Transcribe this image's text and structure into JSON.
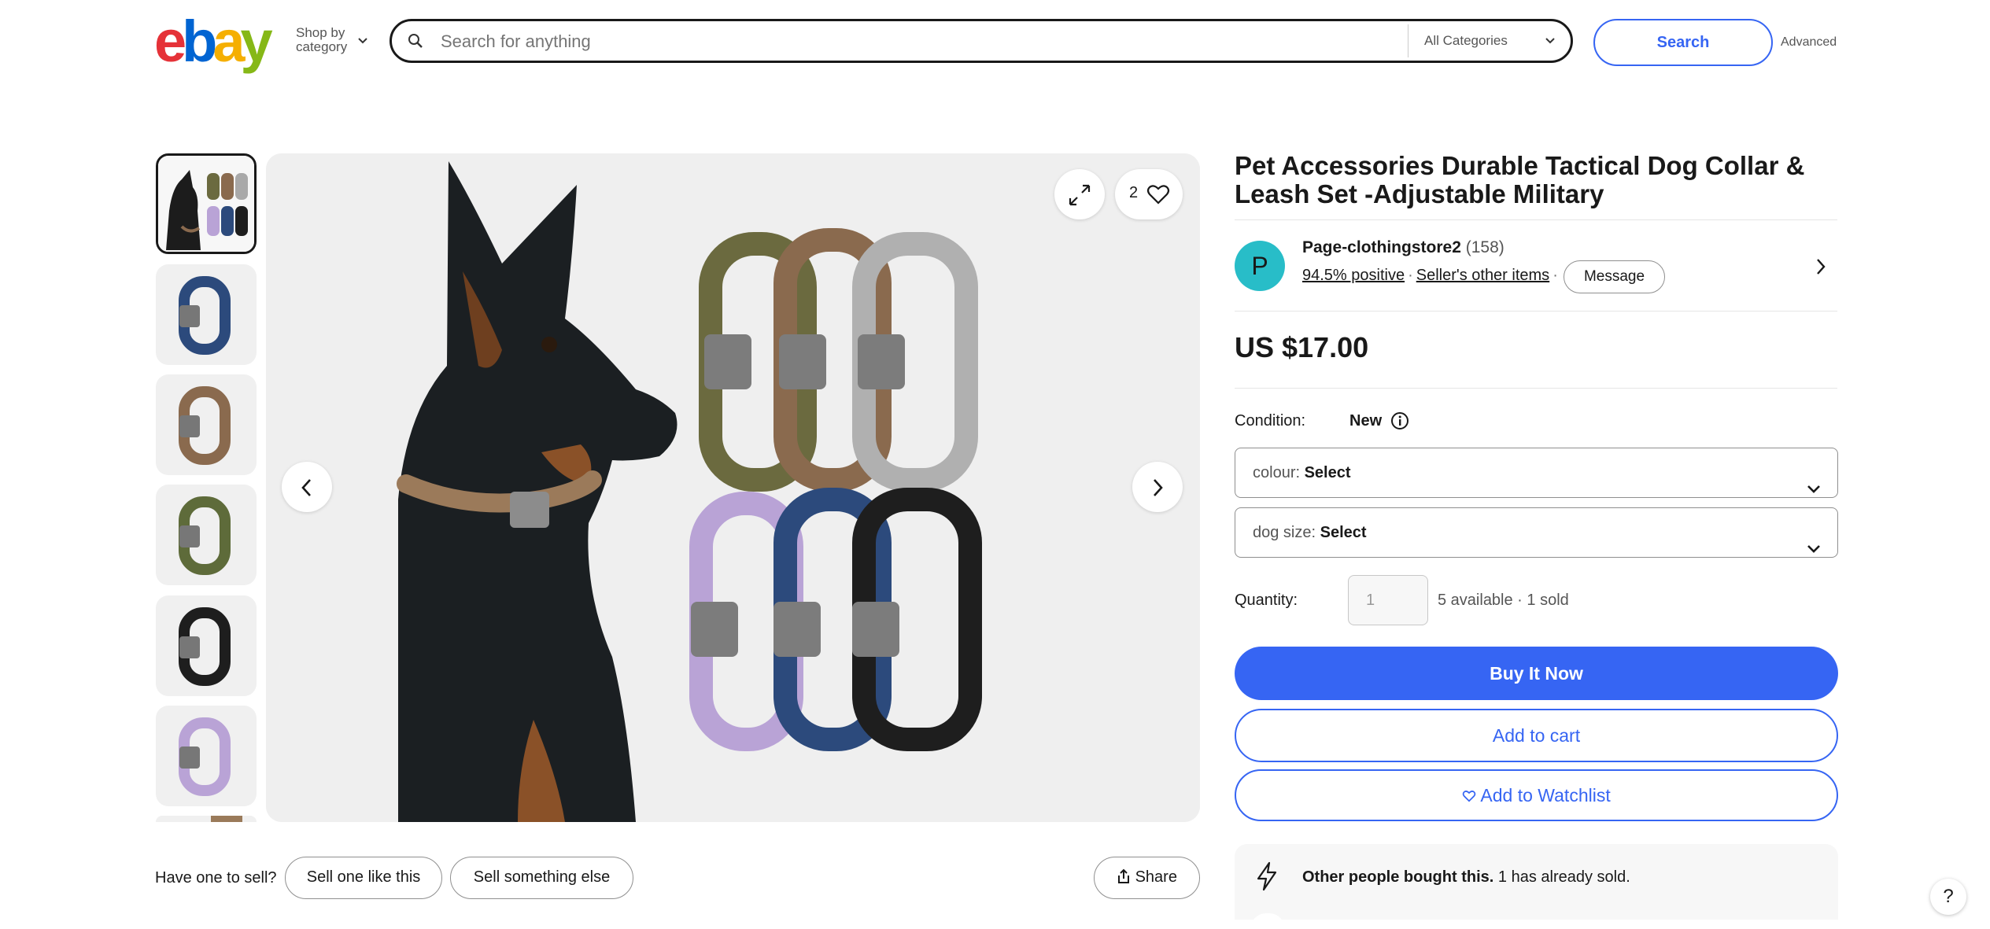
{
  "header": {
    "logo": {
      "e": "e",
      "b": "b",
      "a": "a",
      "y": "y"
    },
    "shop_by": "Shop by",
    "category": "category",
    "search_placeholder": "Search for anything",
    "category_select": "All Categories",
    "search_button": "Search",
    "advanced": "Advanced"
  },
  "gallery": {
    "thumbnail_colors": [
      "#f2f2f2",
      "#2c4a7c",
      "#8a6a4e",
      "#5e6b3a",
      "#1e1e1e",
      "#b9a3d6",
      "#9a7a5a"
    ],
    "favorites_count": "2",
    "icons": [
      "expand-icon",
      "heart-icon",
      "chevron-left-icon",
      "chevron-right-icon"
    ]
  },
  "sell": {
    "prompt": "Have one to sell?",
    "sell_like_this": "Sell one like this",
    "sell_something_else": "Sell something else",
    "share": "Share"
  },
  "product": {
    "title": "Pet Accessories Durable Tactical Dog Collar & Leash Set -Adjustable Military",
    "seller": {
      "avatar_letter": "P",
      "name": "Page-clothingstore2",
      "feedback_count": "(158)",
      "positive": "94.5% positive",
      "other_items": "Seller's other items",
      "message": "Message"
    },
    "price": "US $17.00",
    "condition_label": "Condition:",
    "condition_value": "New",
    "colour_key": "colour:",
    "colour_value": "Select",
    "dogsize_key": "dog size:",
    "dogsize_value": "Select",
    "quantity_label": "Quantity:",
    "quantity_value": "1",
    "availability": "5 available · 1 sold",
    "buy_now": "Buy It Now",
    "add_to_cart": "Add to cart",
    "add_to_watchlist": "Add to Watchlist",
    "promo_bold": "Other people bought this.",
    "promo_rest": "1 has already sold."
  },
  "help": "?",
  "colors": {
    "accent_blue": "#3665f3",
    "avatar_teal": "#28bdc8",
    "ebay_red": "#e53238",
    "ebay_blue": "#0064d2",
    "ebay_yellow": "#f5af02",
    "ebay_green": "#86b817"
  }
}
